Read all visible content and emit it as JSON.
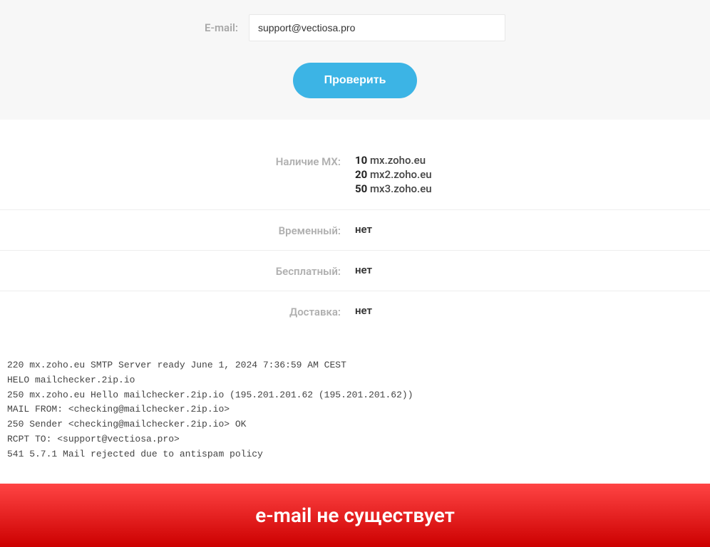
{
  "form": {
    "label": "E-mail:",
    "value": "support@vectiosa.pro",
    "submit_label": "Проверить"
  },
  "results": {
    "mx_label": "Наличие MX:",
    "mx_records": [
      {
        "priority": "10",
        "host": "mx.zoho.eu"
      },
      {
        "priority": "20",
        "host": "mx2.zoho.eu"
      },
      {
        "priority": "50",
        "host": "mx3.zoho.eu"
      }
    ],
    "temporary_label": "Временный:",
    "temporary_value": "нет",
    "free_label": "Бесплатный:",
    "free_value": "нет",
    "delivery_label": "Доставка:",
    "delivery_value": "нет"
  },
  "log": "220 mx.zoho.eu SMTP Server ready June 1, 2024 7:36:59 AM CEST\nHELO mailchecker.2ip.io\n250 mx.zoho.eu Hello mailchecker.2ip.io (195.201.201.62 (195.201.201.62))\nMAIL FROM: <checking@mailchecker.2ip.io>\n250 Sender <checking@mailchecker.2ip.io> OK\nRCPT TO: <support@vectiosa.pro>\n541 5.7.1 Mail rejected due to antispam policy",
  "status": {
    "message": "e-mail не существует"
  }
}
